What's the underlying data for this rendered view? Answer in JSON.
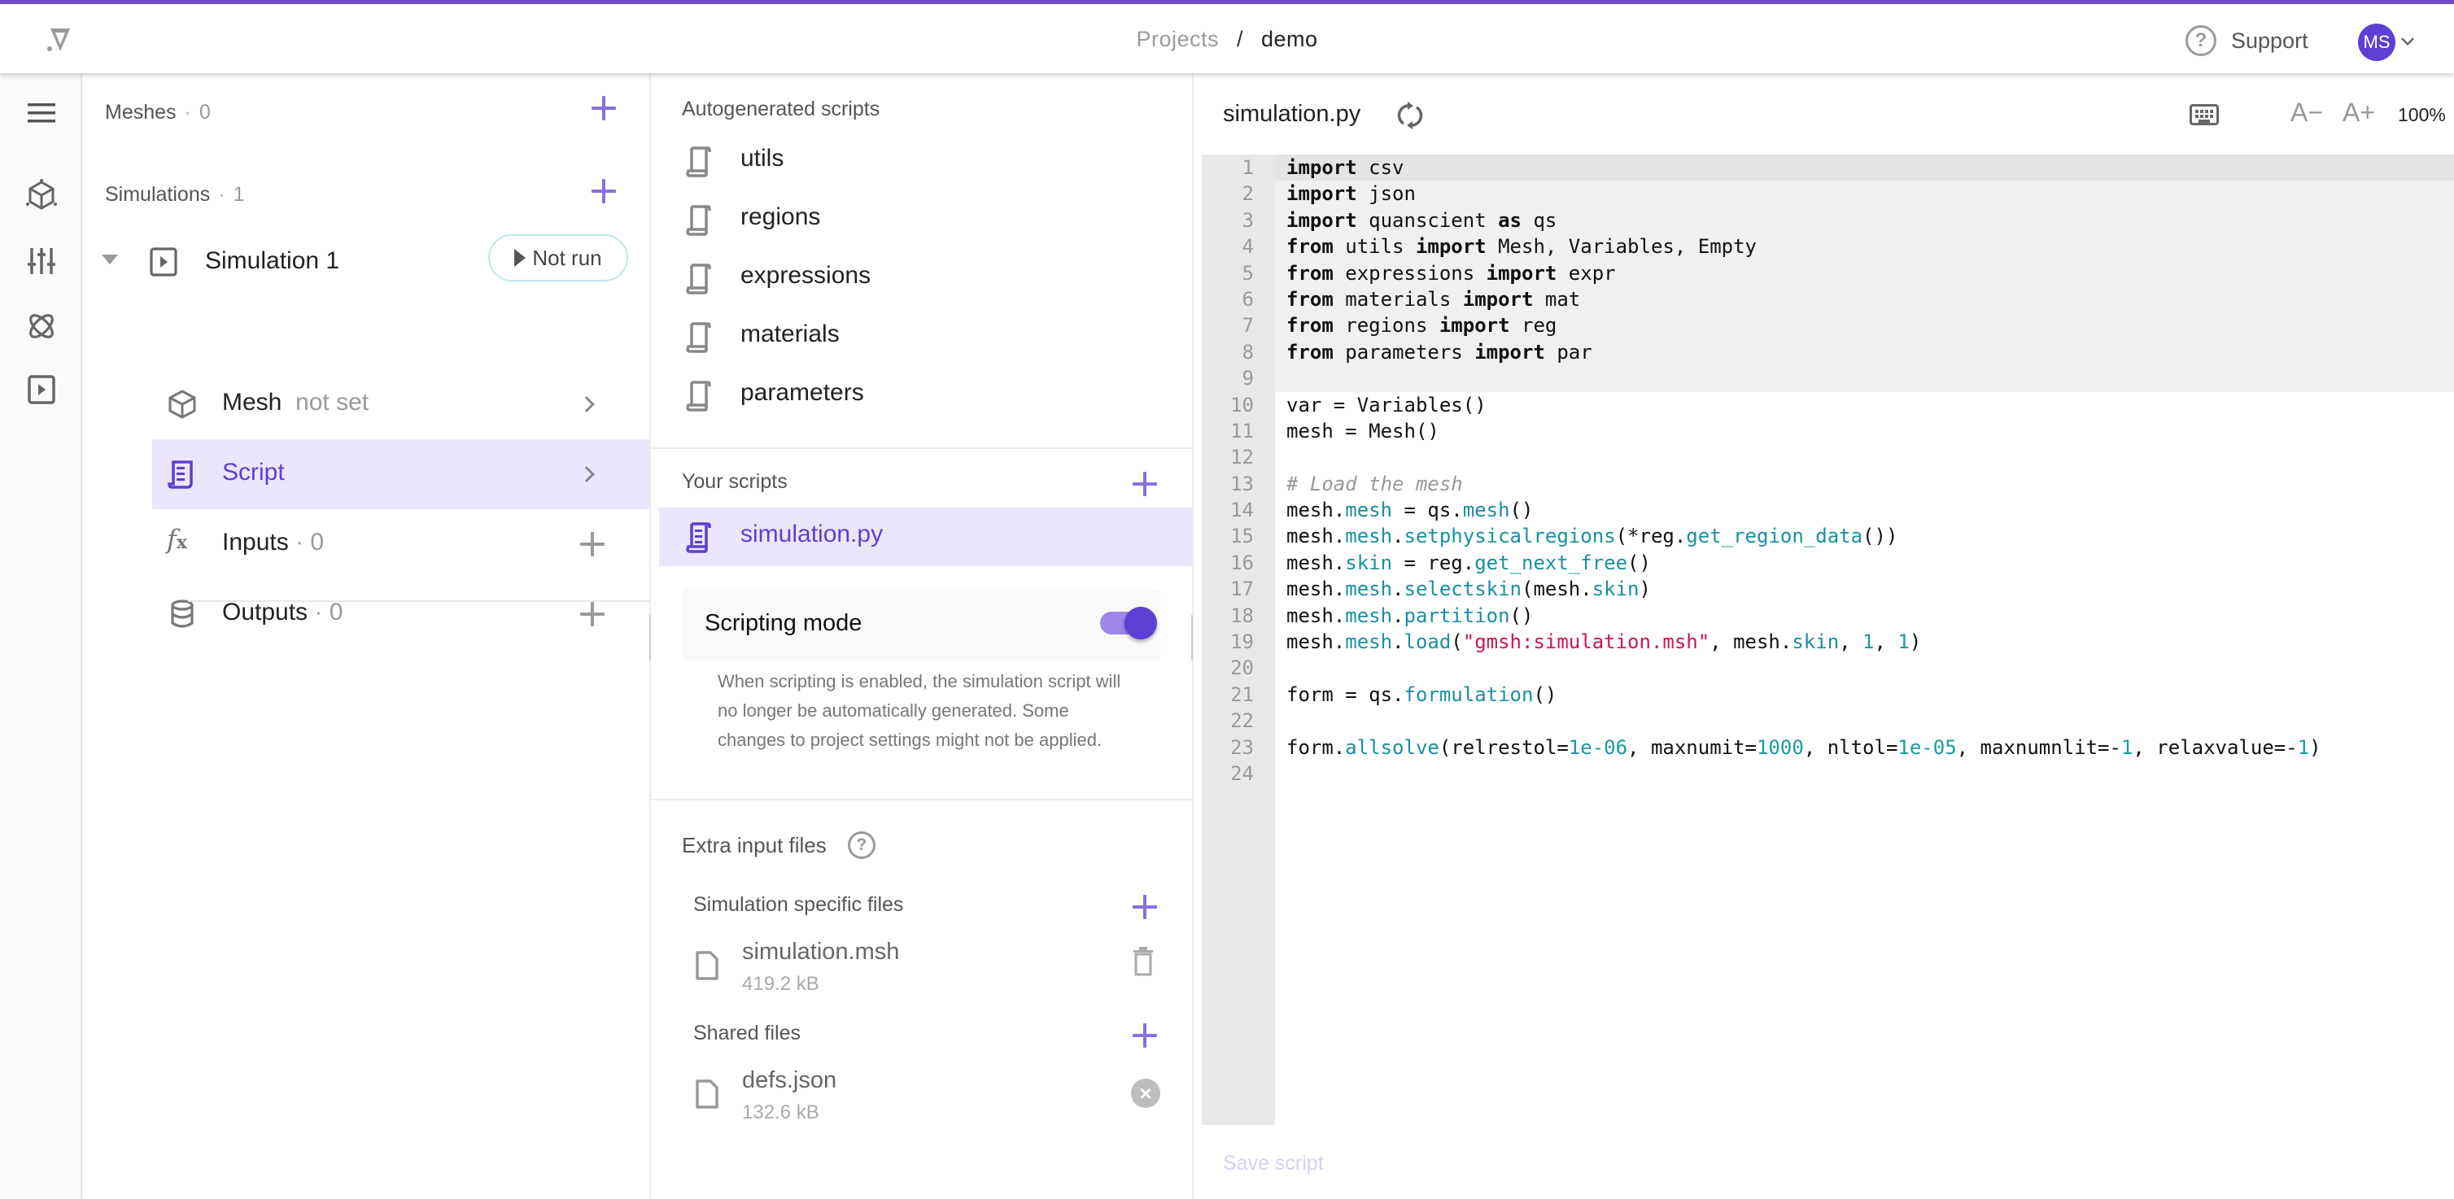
{
  "topbar": {
    "breadcrumb": [
      "Projects",
      "/",
      "demo"
    ],
    "support_label": "Support",
    "user_initials": "MS",
    "accent_color": "#6f4bc9"
  },
  "rail": {
    "items": [
      {
        "name": "menu",
        "icon": "hamburger-icon"
      },
      {
        "name": "geometry",
        "icon": "cube-icon"
      },
      {
        "name": "settings",
        "icon": "sliders-icon"
      },
      {
        "name": "physics",
        "icon": "atom-icon"
      },
      {
        "name": "simulations",
        "icon": "play-square-icon"
      }
    ]
  },
  "tree": {
    "meshes": {
      "label": "Meshes",
      "count": "0"
    },
    "simulations": {
      "label": "Simulations",
      "count": "1"
    },
    "simulation": {
      "name": "Simulation 1",
      "status": "Not run"
    },
    "children": [
      {
        "label": "Mesh",
        "sub": "not set",
        "action": "chevron"
      },
      {
        "label": "Script",
        "sub": "",
        "action": "chevron",
        "active": true
      },
      {
        "label": "Inputs",
        "sub": "· 0",
        "action": "plus"
      },
      {
        "label": "Outputs",
        "sub": "· 0",
        "action": "plus"
      }
    ]
  },
  "scripts": {
    "autogen_label": "Autogenerated scripts",
    "autogen": [
      "utils",
      "regions",
      "expressions",
      "materials",
      "parameters"
    ],
    "yours_label": "Your scripts",
    "yours": [
      "simulation.py"
    ],
    "scripting_mode_label": "Scripting mode",
    "scripting_mode_on": true,
    "scripting_desc": "When scripting is enabled, the simulation script will no longer be automatically generated. Some changes to project settings might not be applied.",
    "extra_label": "Extra input files",
    "sim_files_label": "Simulation specific files",
    "sim_files": [
      {
        "name": "simulation.msh",
        "size": "419.2 kB"
      }
    ],
    "shared_files_label": "Shared files",
    "shared_files": [
      {
        "name": "defs.json",
        "size": "132.6 kB"
      }
    ]
  },
  "editor": {
    "filename": "simulation.py",
    "zoom": "100%",
    "font_decrease": "A−",
    "font_increase": "A+",
    "save_label": "Save script",
    "lines": [
      [
        [
          "kw",
          "import"
        ],
        [
          "",
          "  csv"
        ]
      ],
      [
        [
          "kw",
          "import"
        ],
        [
          "",
          "  json"
        ]
      ],
      [
        [
          "kw",
          "import"
        ],
        [
          "",
          "  quanscient "
        ],
        [
          "kw",
          "as"
        ],
        [
          "",
          " qs"
        ]
      ],
      [
        [
          "kw",
          "from"
        ],
        [
          "",
          " utils "
        ],
        [
          "kw",
          "import"
        ],
        [
          "",
          " Mesh, Variables, Empty"
        ]
      ],
      [
        [
          "kw",
          "from"
        ],
        [
          "",
          " expressions "
        ],
        [
          "kw",
          "import"
        ],
        [
          "",
          " expr"
        ]
      ],
      [
        [
          "kw",
          "from"
        ],
        [
          "",
          " materials "
        ],
        [
          "kw",
          "import"
        ],
        [
          "",
          " mat"
        ]
      ],
      [
        [
          "kw",
          "from"
        ],
        [
          "",
          " regions "
        ],
        [
          "kw",
          "import"
        ],
        [
          "",
          " reg"
        ]
      ],
      [
        [
          "kw",
          "from"
        ],
        [
          "",
          " parameters "
        ],
        [
          "kw",
          "import"
        ],
        [
          "",
          " par"
        ]
      ],
      [],
      [
        [
          "",
          "var = Variables()"
        ]
      ],
      [
        [
          "",
          "mesh = Mesh()"
        ]
      ],
      [],
      [
        [
          "com",
          "# Load the mesh"
        ]
      ],
      [
        [
          "",
          "mesh."
        ],
        [
          "attr",
          "mesh"
        ],
        [
          "",
          " = qs."
        ],
        [
          "attr",
          "mesh"
        ],
        [
          "",
          "()"
        ]
      ],
      [
        [
          "",
          "mesh."
        ],
        [
          "attr",
          "mesh"
        ],
        [
          "",
          "."
        ],
        [
          "attr",
          "setphysicalregions"
        ],
        [
          "",
          "(*reg."
        ],
        [
          "attr",
          "get_region_data"
        ],
        [
          "",
          "())"
        ]
      ],
      [
        [
          "",
          "mesh."
        ],
        [
          "attr",
          "skin"
        ],
        [
          "",
          " = reg."
        ],
        [
          "attr",
          "get_next_free"
        ],
        [
          "",
          "()"
        ]
      ],
      [
        [
          "",
          "mesh."
        ],
        [
          "attr",
          "mesh"
        ],
        [
          "",
          "."
        ],
        [
          "attr",
          "selectskin"
        ],
        [
          "",
          "(mesh."
        ],
        [
          "attr",
          "skin"
        ],
        [
          "",
          ")"
        ]
      ],
      [
        [
          "",
          "mesh."
        ],
        [
          "attr",
          "mesh"
        ],
        [
          "",
          "."
        ],
        [
          "attr",
          "partition"
        ],
        [
          "",
          "()"
        ]
      ],
      [
        [
          "",
          "mesh."
        ],
        [
          "attr",
          "mesh"
        ],
        [
          "",
          "."
        ],
        [
          "attr",
          "load"
        ],
        [
          "",
          "("
        ],
        [
          "str",
          "\"gmsh:simulation.msh\""
        ],
        [
          "",
          ", mesh."
        ],
        [
          "attr",
          "skin"
        ],
        [
          "",
          ", "
        ],
        [
          "numv",
          "1"
        ],
        [
          "",
          ", "
        ],
        [
          "numv",
          "1"
        ],
        [
          "",
          ")"
        ]
      ],
      [],
      [
        [
          "",
          "form = qs."
        ],
        [
          "attr",
          "formulation"
        ],
        [
          "",
          "()"
        ]
      ],
      [],
      [
        [
          "",
          "form."
        ],
        [
          "attr",
          "allsolve"
        ],
        [
          "",
          "(relrestol="
        ],
        [
          "numv",
          "1e-06"
        ],
        [
          "",
          ", maxnumit="
        ],
        [
          "numv",
          "1000"
        ],
        [
          "",
          ", nltol="
        ],
        [
          "numv",
          "1e-05"
        ],
        [
          "",
          ", maxnumnlit=-"
        ],
        [
          "numv",
          "1"
        ],
        [
          "",
          ", relaxvalue=-"
        ],
        [
          "numv",
          "1"
        ],
        [
          "",
          ")"
        ]
      ],
      []
    ]
  }
}
